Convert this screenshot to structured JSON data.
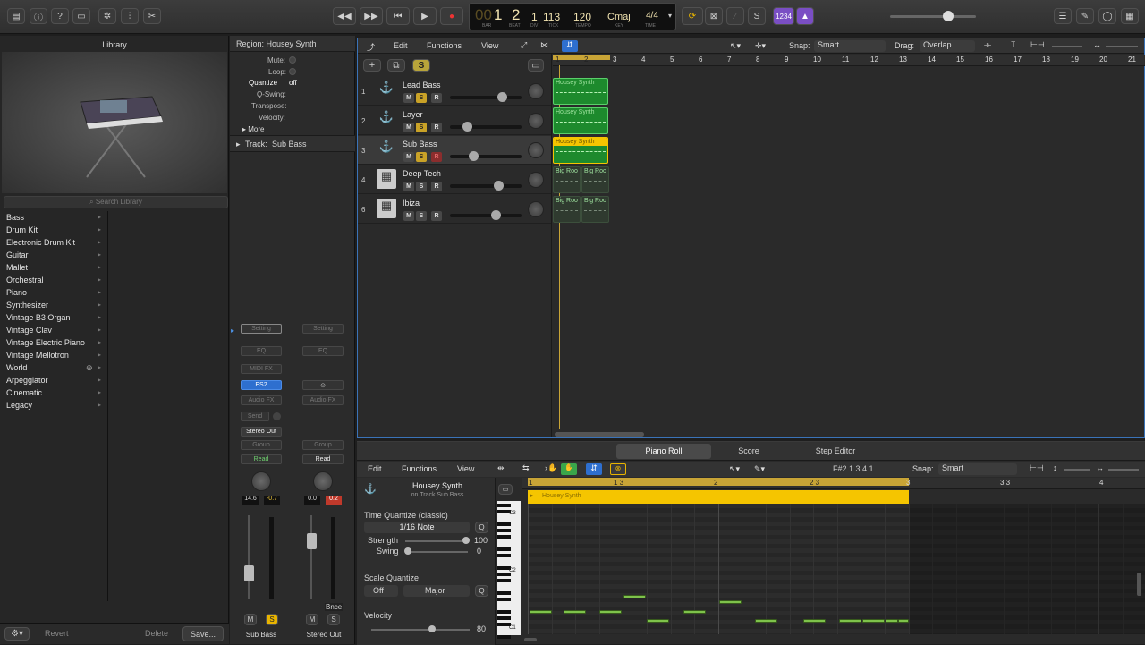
{
  "transport": {
    "bar": "1",
    "beat": "2",
    "div": "1",
    "tick": "113",
    "tempo": "120",
    "key": "Cmaj",
    "time_signature": "4/4",
    "labels": {
      "bar": "BAR",
      "beat": "BEAT",
      "div": "DIV",
      "tick": "TICK",
      "tempo": "TEMPO",
      "key": "KEY",
      "time": "TIME"
    },
    "count_in": "1234"
  },
  "library": {
    "title": "Library",
    "search_placeholder": "Search Library",
    "items": [
      "Bass",
      "Drum Kit",
      "Electronic Drum Kit",
      "Guitar",
      "Mallet",
      "Orchestral",
      "Piano",
      "Synthesizer",
      "Vintage B3 Organ",
      "Vintage Clav",
      "Vintage Electric Piano",
      "Vintage Mellotron",
      "World",
      "Arpeggiator",
      "Cinematic",
      "Legacy"
    ],
    "revert_label": "Revert",
    "delete_label": "Delete",
    "save_label": "Save..."
  },
  "inspector": {
    "region_header": "Region: Housey Synth",
    "mute": "Mute:",
    "loop": "Loop:",
    "quantize": "Quantize",
    "quantize_value": "off",
    "qswing": "Q-Swing:",
    "transpose": "Transpose:",
    "velocity": "Velocity:",
    "more": "More",
    "track_header": "Track:",
    "track_name": "Sub Bass",
    "strip1": {
      "setting": "Setting",
      "eq": "EQ",
      "midifx": "MIDI FX",
      "instrument": "ES2",
      "audiofx": "Audio FX",
      "send": "Send",
      "output": "Stereo Out",
      "group": "Group",
      "automation": "Read",
      "vol": "14.6",
      "pan": "-0.7",
      "m": "M",
      "s": "S",
      "name": "Sub Bass"
    },
    "strip2": {
      "setting": "Setting",
      "eq": "EQ",
      "audiofx": "Audio FX",
      "group": "Group",
      "automation": "Read",
      "vol": "0.0",
      "pan": "0.2",
      "m": "M",
      "s": "S",
      "bnce": "Bnce",
      "name": "Stereo Out"
    }
  },
  "tracks_menu": {
    "edit": "Edit",
    "functions": "Functions",
    "view": "View",
    "snap_label": "Snap:",
    "snap_value": "Smart",
    "drag_label": "Drag:",
    "drag_value": "Overlap"
  },
  "tracks": [
    {
      "num": "1",
      "name": "Lead Bass",
      "m": "M",
      "s": "S",
      "r": "R",
      "vol": 0.75,
      "regions": [
        "Housey Synth"
      ],
      "type": "synth"
    },
    {
      "num": "2",
      "name": "Layer",
      "m": "M",
      "s": "S",
      "r": "R",
      "vol": 0.2,
      "regions": [
        "Housey Synth"
      ],
      "type": "synth"
    },
    {
      "num": "3",
      "name": "Sub Bass",
      "m": "M",
      "s": "S",
      "r": "R",
      "vol": 0.3,
      "regions": [
        "Housey Synth"
      ],
      "type": "synth"
    },
    {
      "num": "4",
      "name": "Deep Tech",
      "m": "M",
      "s": "S",
      "r": "R",
      "vol": 0.7,
      "regions": [
        "Big Roo",
        "Big Roo"
      ],
      "type": "drum"
    },
    {
      "num": "6",
      "name": "Ibiza",
      "m": "M",
      "s": "S",
      "r": "R",
      "vol": 0.65,
      "regions": [
        "Big Roo",
        "Big Roo"
      ],
      "type": "drum"
    }
  ],
  "ruler": [
    "1",
    "2",
    "3",
    "4",
    "5",
    "6",
    "7",
    "8",
    "9",
    "10",
    "11",
    "12",
    "13",
    "14",
    "15",
    "16",
    "17",
    "18",
    "19",
    "20",
    "21"
  ],
  "piano_roll": {
    "tabs": [
      "Piano Roll",
      "Score",
      "Step Editor"
    ],
    "edit": "Edit",
    "functions": "Functions",
    "view": "View",
    "position": "F#2  1 3 4 1",
    "snap_label": "Snap:",
    "snap_value": "Smart",
    "region_name": "Housey Synth",
    "region_track": "on Track Sub Bass",
    "time_quantize": "Time Quantize (classic)",
    "quantize_value": "1/16 Note",
    "q": "Q",
    "strength_label": "Strength",
    "strength": "100",
    "swing_label": "Swing",
    "swing": "0",
    "scale_quantize": "Scale Quantize",
    "scale_off": "Off",
    "scale_major": "Major",
    "velocity_label": "Velocity",
    "velocity": "80",
    "ruler": [
      "1",
      "1 3",
      "2",
      "2 3",
      "3",
      "3 3",
      "4"
    ],
    "keys": [
      "C3",
      "C2",
      "C1"
    ]
  }
}
